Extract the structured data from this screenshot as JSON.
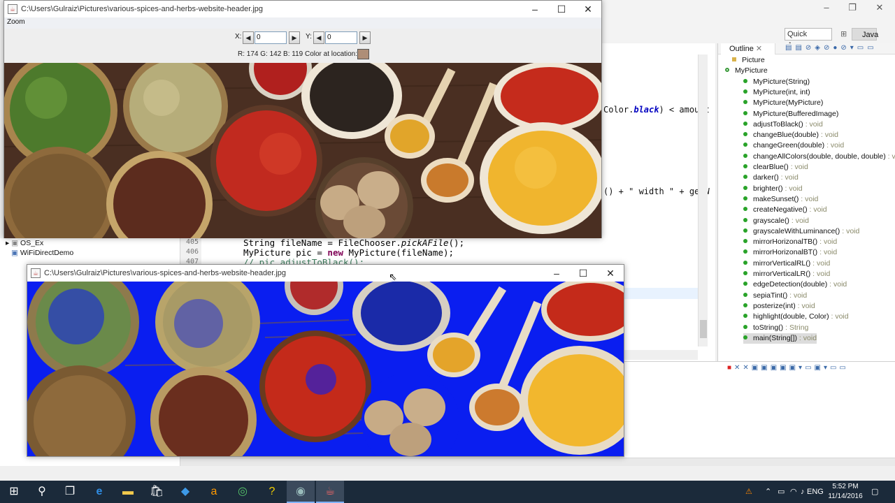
{
  "eclipse": {
    "quick_access": "Quick Access",
    "perspective": "Java",
    "outline_tab": "Outline",
    "outline_items": [
      {
        "name": "Picture",
        "ret": ""
      },
      {
        "name": "MyPicture",
        "ret": ""
      },
      {
        "name": "MyPicture(String)",
        "ret": ""
      },
      {
        "name": "MyPicture(int, int)",
        "ret": ""
      },
      {
        "name": "MyPicture(MyPicture)",
        "ret": ""
      },
      {
        "name": "MyPicture(BufferedImage)",
        "ret": ""
      },
      {
        "name": "adjustToBlack()",
        "ret": " : void"
      },
      {
        "name": "changeBlue(double)",
        "ret": " : void"
      },
      {
        "name": "changeGreen(double)",
        "ret": " : void"
      },
      {
        "name": "changeAllColors(double, double, double)",
        "ret": " : vo"
      },
      {
        "name": "clearBlue()",
        "ret": " : void"
      },
      {
        "name": "darker()",
        "ret": " : void"
      },
      {
        "name": "brighter()",
        "ret": " : void"
      },
      {
        "name": "makeSunset()",
        "ret": " : void"
      },
      {
        "name": "createNegative()",
        "ret": " : void"
      },
      {
        "name": "grayscale()",
        "ret": " : void"
      },
      {
        "name": "grayscaleWithLuminance()",
        "ret": " : void"
      },
      {
        "name": "mirrorHorizonalTB()",
        "ret": " : void"
      },
      {
        "name": "mirrorHorizonalBT()",
        "ret": " : void"
      },
      {
        "name": "mirrorVerticalRL()",
        "ret": " : void"
      },
      {
        "name": "mirrorVerticalLR()",
        "ret": " : void"
      },
      {
        "name": "edgeDetection(double)",
        "ret": " : void"
      },
      {
        "name": "sepiaTint()",
        "ret": " : void"
      },
      {
        "name": "posterize(int)",
        "ret": " : void"
      },
      {
        "name": "highlight(double, Color)",
        "ret": " : void"
      },
      {
        "name": "toString()",
        "ret": " : String"
      },
      {
        "name": "main(String[])",
        "ret": " : void"
      }
    ],
    "code_frag_1_a": "Color.",
    "code_frag_1_b": "black",
    "code_frag_1_c": ") < amount",
    "code_frag_2_a": "() + \" width \" + getW",
    "packages": [
      "OS_Ex",
      "WiFiDirectDemo"
    ],
    "line_numbers": [
      "405",
      "406",
      "407"
    ],
    "code_line_1_a": "String fileName = FileChooser.",
    "code_line_1_b": "pickAFile",
    "code_line_1_c": "();",
    "code_line_2_a": "MyPicture pic = ",
    "code_line_2_b": "new",
    "code_line_2_c": " MyPicture(fileName);",
    "code_line_3": "// pic.adjustToBlack();"
  },
  "window1": {
    "title": "C:\\Users\\Gulraiz\\Pictures\\various-spices-and-herbs-website-header.jpg",
    "menu": "Zoom",
    "x_label": "X:",
    "x_value": "0",
    "y_label": "Y:",
    "y_value": "0",
    "rgb_text": "R: 174  G: 142  B: 119  Color at location:",
    "swatch_color": "#ae8e77"
  },
  "window2": {
    "title": "C:\\Users\\Gulraiz\\Pictures\\various-spices-and-herbs-website-header.jpg"
  },
  "taskbar": {
    "lang": "ENG",
    "time": "5:52 PM",
    "date": "11/14/2016"
  },
  "colors": {
    "posterize_blue": "#0a1ef0",
    "taskbar": "#1b2a3a"
  }
}
